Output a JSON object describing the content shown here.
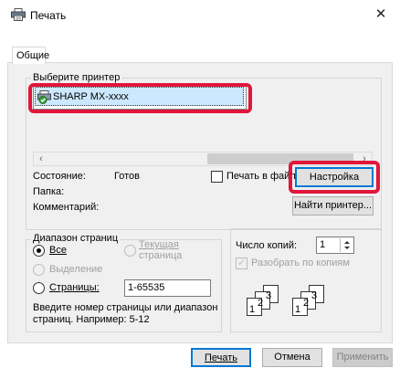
{
  "window": {
    "title": "Печать",
    "close_symbol": "✕"
  },
  "tabs": [
    {
      "label": "Общие"
    }
  ],
  "select_printer": {
    "group_label": "Выберите принтер",
    "printers": [
      {
        "name": "SHARP MX-xxxx"
      }
    ],
    "scroll_left": "‹",
    "scroll_right": "›"
  },
  "status": {
    "state_label": "Состояние:",
    "state_value": "Готов",
    "folder_label": "Папка:",
    "comment_label": "Комментарий:",
    "print_to_file_label": "Печать в файл",
    "print_to_file_checked": false,
    "settings_button": "Настройка",
    "find_printer_button": "Найти принтер..."
  },
  "page_range": {
    "group_label": "Диапазон страниц",
    "all_label": "Все",
    "current_page_label_line1": "Текущая",
    "current_page_label_line2": "страница",
    "selection_label": "Выделение",
    "pages_label": "Страницы:",
    "pages_value": "1-65535",
    "hint_line1": "Введите номер страницы или диапазон",
    "hint_line2": "страниц.  Например: 5-12",
    "selected": "all"
  },
  "copies": {
    "count_label": "Число копий:",
    "count_value": "1",
    "collate_label": "Разобрать по копиям",
    "collate_checked": true,
    "collate_icon_pages": [
      "1",
      "2",
      "3",
      "1",
      "2",
      "3"
    ]
  },
  "buttons": {
    "print": "Печать",
    "cancel": "Отмена",
    "apply": "Применить"
  },
  "colors": {
    "highlight": "#e1163c",
    "selection": "#cce8ff",
    "accent": "#0078d7"
  }
}
